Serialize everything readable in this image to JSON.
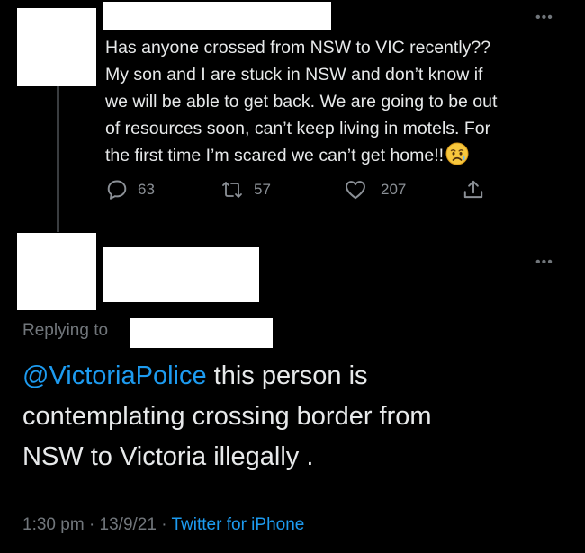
{
  "parent_tweet": {
    "text_lines": [
      "Has anyone crossed from NSW to VIC recently??",
      "My son and I are stuck in NSW and don’t know if",
      "we will be able to get back. We are going to be out",
      "of resources soon, can’t keep living in motels. For",
      "the first time I’m scared we can’t get home!!"
    ],
    "emoji": "sad-but-relieved-face-emoji",
    "actions": {
      "replies": "63",
      "retweets": "57",
      "likes": "207"
    },
    "more_icon": "more-horizontal-icon"
  },
  "reply_tweet": {
    "replying_to_label": "Replying to",
    "mention": "@VictoriaPolice",
    "text_lines": [
      " this person is",
      "contemplating crossing border from",
      "NSW to Victoria illegally ."
    ],
    "time": "1:30 pm",
    "separator": "·",
    "date": "13/9/21",
    "source": "Twitter for iPhone",
    "more_icon": "more-horizontal-icon"
  },
  "colors": {
    "background": "#000000",
    "text": "#e7e9ea",
    "muted": "#71767b",
    "link": "#1d9bf0",
    "redaction": "#ffffff"
  }
}
